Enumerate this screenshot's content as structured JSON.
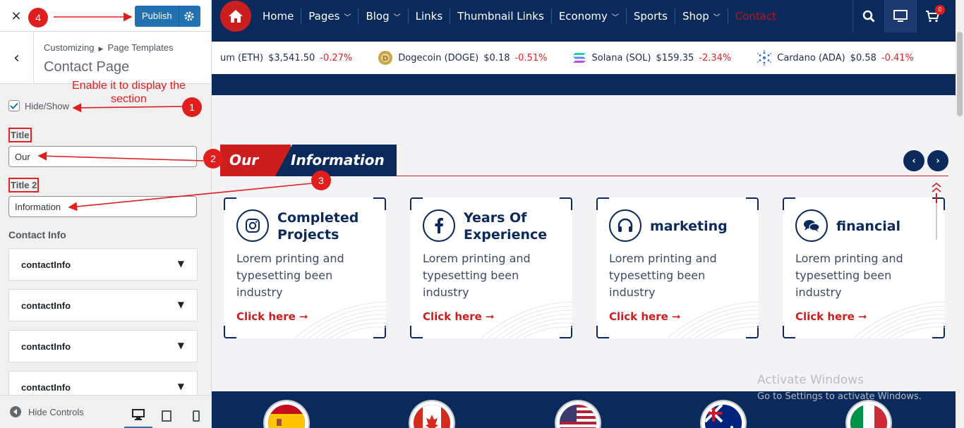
{
  "customizer": {
    "close_label": "×",
    "publish_label": "Publish",
    "breadcrumb": [
      "Customizing",
      "Page Templates"
    ],
    "section_title": "Contact Page",
    "hide_show_label": "Hide/Show",
    "hide_show_checked": true,
    "title_label": "Title",
    "title_value": "Our",
    "title2_label": "Title 2",
    "title2_value": "Information",
    "contact_info_label": "Contact Info",
    "contact_items": [
      "contactInfo",
      "contactInfo",
      "contactInfo",
      "contactInfo"
    ],
    "footer": {
      "hide_controls_label": "Hide Controls"
    }
  },
  "annotations": {
    "note": "Enable it to display the section",
    "markers": [
      "1",
      "2",
      "3",
      "4"
    ]
  },
  "site": {
    "nav": [
      {
        "label": "Home",
        "dropdown": false
      },
      {
        "label": "Pages",
        "dropdown": true
      },
      {
        "label": "Blog",
        "dropdown": true
      },
      {
        "label": "Links",
        "dropdown": false
      },
      {
        "label": "Thumbnail Links",
        "dropdown": false
      },
      {
        "label": "Economy",
        "dropdown": true
      },
      {
        "label": "Sports",
        "dropdown": false
      },
      {
        "label": "Shop",
        "dropdown": true
      },
      {
        "label": "Contact",
        "dropdown": false
      }
    ],
    "cart_count": "0",
    "ticker": [
      {
        "name": "um (ETH)",
        "price": "$3,541.50",
        "change": "-0.27%",
        "icon": "ethereum-icon"
      },
      {
        "name": "Dogecoin (DOGE)",
        "price": "$0.18",
        "change": "-0.51%",
        "icon": "dogecoin-icon"
      },
      {
        "name": "Solana (SOL)",
        "price": "$159.35",
        "change": "-2.34%",
        "icon": "solana-icon"
      },
      {
        "name": "Cardano (ADA)",
        "price": "$0.58",
        "change": "-0.41%",
        "icon": "cardano-icon"
      }
    ],
    "section_heading": {
      "word1": "Our",
      "word2": "Information"
    },
    "cards": [
      {
        "title": "Completed Projects",
        "text": "Lorem printing and typesetting been industry",
        "link": "Click here",
        "icon": "instagram-icon"
      },
      {
        "title": "Years Of Experience",
        "text": "Lorem printing and typesetting been industry",
        "link": "Click here",
        "icon": "facebook-icon"
      },
      {
        "title": "marketing",
        "text": "Lorem printing and typesetting been industry",
        "link": "Click here",
        "icon": "headphones-icon"
      },
      {
        "title": "financial",
        "text": "Lorem printing and typesetting been industry",
        "link": "Click here",
        "icon": "chat-icon"
      }
    ],
    "flags": [
      "spain-flag",
      "canada-flag",
      "usa-flag",
      "australia-flag",
      "italy-flag"
    ]
  },
  "watermark": {
    "line1": "Activate Windows",
    "line2": "Go to Settings to activate Windows."
  },
  "colors": {
    "navy": "#0b2a5c",
    "red": "#cc1e1e",
    "wp_blue": "#2271b1",
    "annotation_red": "#e01e1e"
  }
}
